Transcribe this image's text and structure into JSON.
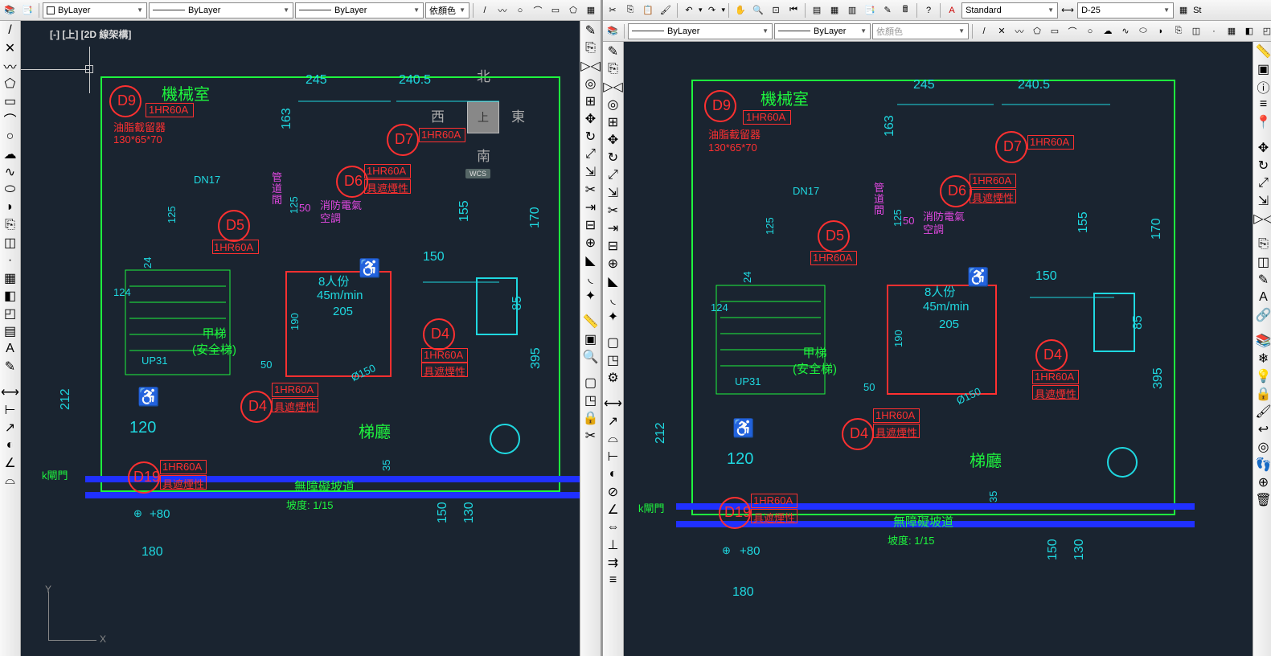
{
  "toolbar": {
    "layer_value": "ByLayer",
    "linetype_value": "ByLayer",
    "lineweight_value": "ByLayer",
    "color_value": "依顏色",
    "text_style": "Standard",
    "dim_style": "D-25",
    "st_label": "St"
  },
  "viewport_label": "[-] [上] [2D 線架構]",
  "viewcube": {
    "top": "上",
    "n": "北",
    "s": "南",
    "e": "東",
    "w": "西",
    "wcs": "WCS"
  },
  "ucs": {
    "x": "X",
    "y": "Y"
  },
  "drawing": {
    "title_mech": "機械室",
    "grease": "油脂截留器",
    "grease_dim": "130*65*70",
    "d9": "D9",
    "door_spec": "1HR60A",
    "dn17": "DN17",
    "d5": "D5",
    "d6": "D6",
    "d7": "D7",
    "d4": "D4",
    "d19": "D19",
    "pipe_lbl": "管\n道\n間",
    "fire_lbl": "消防電氣\n空調",
    "smoke_lbl": "具遮煙性",
    "elevator_cap": "8人份",
    "elevator_speed": "45m/min",
    "elevator_load": "205",
    "stair_lbl": "甲梯\n(安全梯)",
    "up_lbl": "UP31",
    "lobby_lbl": "梯廳",
    "ramp_lbl": "無障礙坡道",
    "ramp_slope": "坡度:   1/15",
    "gate_lbl": "k閘門",
    "wheelchair_120": "120",
    "plus80": "+80",
    "dim_245": "245",
    "dim_2405": "240.5",
    "dim_163": "163",
    "dim_125": "125",
    "dim_24": "24",
    "dim_124": "124",
    "dim_212": "212",
    "dim_180": "180",
    "dim_155": "155",
    "dim_170": "170",
    "dim_85": "85",
    "dim_395": "395",
    "dim_150": "150",
    "dim_150b": "150",
    "dim_130": "130",
    "dim_190": "190",
    "dim_35": "35",
    "dim_50": "50",
    "dim_150_small": "50",
    "phi150": "Ø150"
  }
}
